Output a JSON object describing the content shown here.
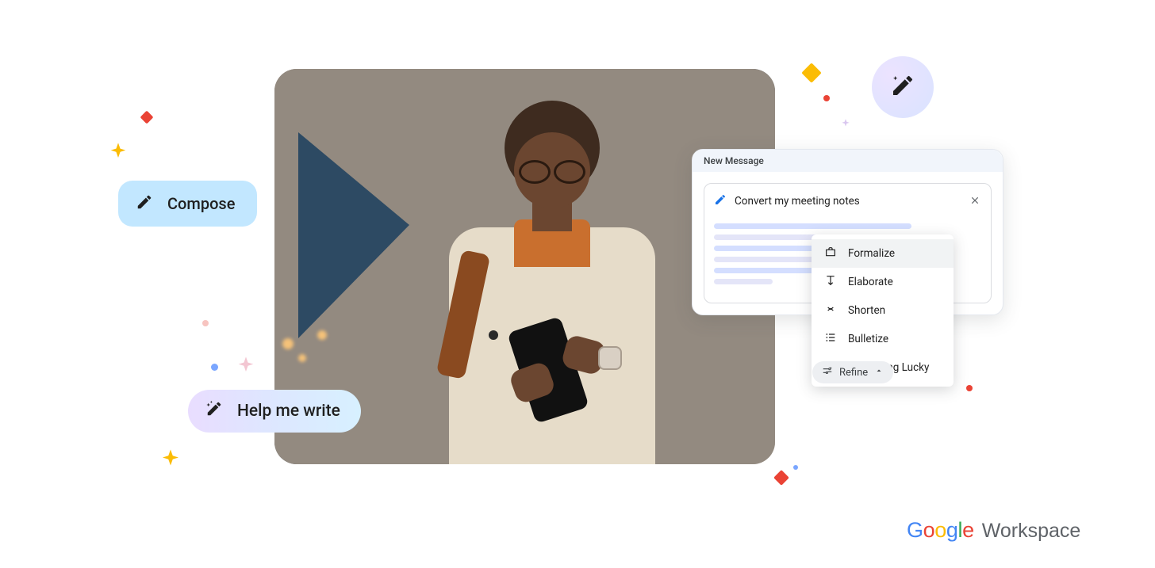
{
  "compose": {
    "label": "Compose"
  },
  "help_me_write": {
    "label": "Help me write"
  },
  "new_message": {
    "title": "New Message",
    "prompt_text": "Convert my meeting notes"
  },
  "refine_menu": {
    "items": [
      {
        "label": "Formalize"
      },
      {
        "label": "Elaborate"
      },
      {
        "label": "Shorten"
      },
      {
        "label": "Bulletize"
      },
      {
        "label": "I'm Feeling Lucky"
      }
    ]
  },
  "refine_chip": {
    "label": "Refine"
  },
  "brand": {
    "google": "Google",
    "workspace": "Workspace"
  }
}
